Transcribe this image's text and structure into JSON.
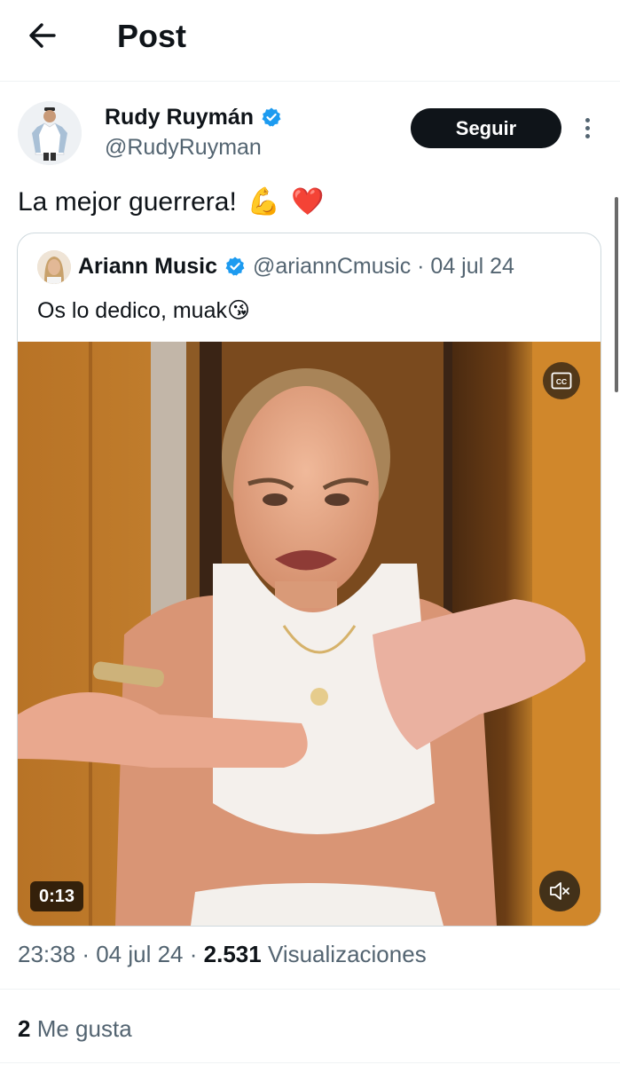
{
  "header": {
    "title": "Post",
    "back_icon": "arrow-left-icon"
  },
  "post": {
    "author_name": "Rudy Ruymán",
    "author_handle": "@RudyRuyman",
    "follow_label": "Seguir",
    "text": "La mejor guerrera!",
    "emoji_1": "💪",
    "emoji_2": "❤️",
    "time": "23:38",
    "date": "04 jul 24",
    "views_count": "2.531",
    "views_label": "Visualizaciones",
    "likes_count": "2",
    "likes_label": "Me gusta"
  },
  "quote": {
    "author_name": "Ariann Music",
    "author_handle": "@ariannCmusic",
    "date": "04 jul 24",
    "text": "Os lo dedico, muak",
    "emoji": "😘",
    "video_duration": "0:13"
  },
  "colors": {
    "verified_blue": "#1d9bf0",
    "text_primary": "#0f1419",
    "text_secondary": "#536471",
    "border": "#cfd9de"
  }
}
